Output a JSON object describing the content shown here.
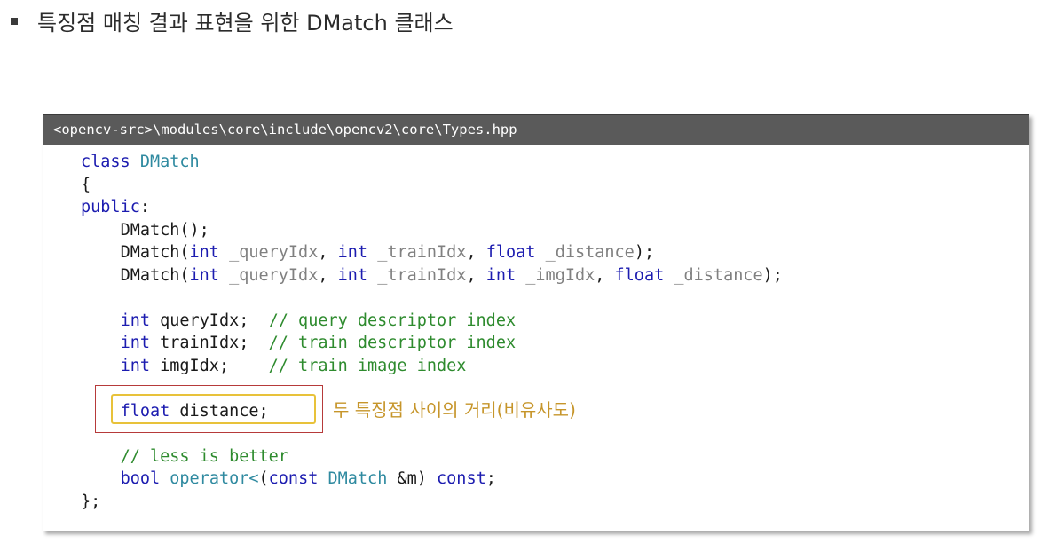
{
  "slide": {
    "title": "특징점 매칭 결과 표현을 위한 DMatch 클래스"
  },
  "code_box": {
    "path": "<opencv-src>\\modules\\core\\include\\opencv2\\core\\Types.hpp",
    "highlight_annotation": "두 특징점 사이의 거리(비유사도)",
    "tokens": {
      "class": "class",
      "DMatch": "DMatch",
      "open_brace": "{",
      "public": "public",
      "colon": ":",
      "ctor0": "DMatch();",
      "DMatch_paren": "DMatch(",
      "int": "int",
      "float": "float",
      "queryIdx_p": "_queryIdx",
      "trainIdx_p": "_trainIdx",
      "imgIdx_p": "_imgIdx",
      "distance_p": "_distance",
      "comma": ", ",
      "end": ");",
      "queryIdx_decl": " queryIdx;  ",
      "c_query": "// query descriptor index",
      "trainIdx_decl": " trainIdx;  ",
      "c_train": "// train descriptor index",
      "imgIdx_decl": " imgIdx;    ",
      "c_img": "// train image index",
      "distance_decl": " distance;",
      "c_less": "// less is better",
      "bool": "bool",
      "operator": "operator<",
      "lparen": "(",
      "const": "const",
      "amp_m": " &m",
      "rparen": ") ",
      "semicolon": ";",
      "close": "};"
    }
  }
}
